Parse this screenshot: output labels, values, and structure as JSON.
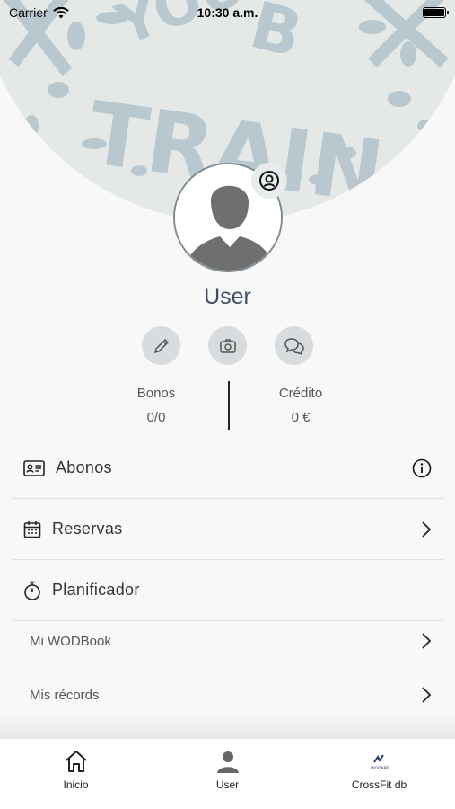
{
  "status_bar": {
    "carrier": "Carrier",
    "time": "10:30 a.m."
  },
  "hero": {
    "art_text": "YOUR BOX TRAIN"
  },
  "profile": {
    "name": "User"
  },
  "stats": {
    "bonos": {
      "label": "Bonos",
      "value": "0/0"
    },
    "credito": {
      "label": "Crédito",
      "value": "0 €"
    }
  },
  "menu": {
    "abonos": "Abonos",
    "reservas": "Reservas",
    "planificador": "Planificador",
    "wodbook": "Mi WODBook",
    "records": "Mis récords"
  },
  "tabbar": {
    "inicio": "Inicio",
    "user": "User",
    "crossfit": "CrossFit db",
    "crossfit_logo_text": "WODAPP"
  }
}
